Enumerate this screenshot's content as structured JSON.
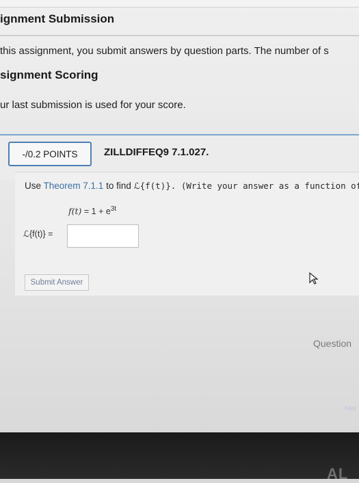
{
  "assignment": {
    "submission_heading": "ignment Submission",
    "submission_text": "this assignment, you submit answers by question parts. The number of s",
    "scoring_heading": "signment Scoring",
    "scoring_text": "ur last submission is used for your score."
  },
  "question": {
    "points": "-/0.2 POINTS",
    "title": "ZILLDIFFEQ9 7.1.027.",
    "prompt_pre": "Use ",
    "prompt_link": "Theorem 7.1.1",
    "prompt_mid": " to find ",
    "prompt_expr": "ℒ{f(t)}",
    "prompt_post": ". (Write your answer as a function of s.)",
    "function_lhs": "f(t)",
    "function_rhs": " = 1 + e",
    "function_exp": "3t",
    "answer_label": "ℒ{f(t)} =",
    "answer_value": "",
    "submit_label": "Submit Answer"
  },
  "footer": {
    "question_link": "Question",
    "home_link": "Hor",
    "device_logo": "AL"
  }
}
